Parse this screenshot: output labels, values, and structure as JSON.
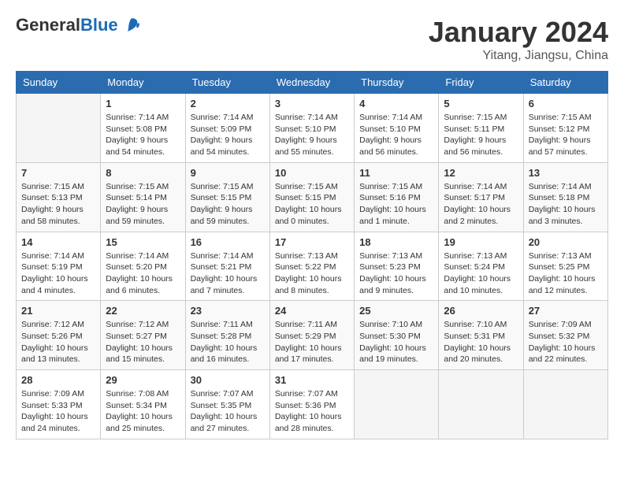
{
  "header": {
    "logo_general": "General",
    "logo_blue": "Blue",
    "month_title": "January 2024",
    "location": "Yitang, Jiangsu, China"
  },
  "weekdays": [
    "Sunday",
    "Monday",
    "Tuesday",
    "Wednesday",
    "Thursday",
    "Friday",
    "Saturday"
  ],
  "weeks": [
    [
      {
        "day": "",
        "info": ""
      },
      {
        "day": "1",
        "info": "Sunrise: 7:14 AM\nSunset: 5:08 PM\nDaylight: 9 hours\nand 54 minutes."
      },
      {
        "day": "2",
        "info": "Sunrise: 7:14 AM\nSunset: 5:09 PM\nDaylight: 9 hours\nand 54 minutes."
      },
      {
        "day": "3",
        "info": "Sunrise: 7:14 AM\nSunset: 5:10 PM\nDaylight: 9 hours\nand 55 minutes."
      },
      {
        "day": "4",
        "info": "Sunrise: 7:14 AM\nSunset: 5:10 PM\nDaylight: 9 hours\nand 56 minutes."
      },
      {
        "day": "5",
        "info": "Sunrise: 7:15 AM\nSunset: 5:11 PM\nDaylight: 9 hours\nand 56 minutes."
      },
      {
        "day": "6",
        "info": "Sunrise: 7:15 AM\nSunset: 5:12 PM\nDaylight: 9 hours\nand 57 minutes."
      }
    ],
    [
      {
        "day": "7",
        "info": "Sunrise: 7:15 AM\nSunset: 5:13 PM\nDaylight: 9 hours\nand 58 minutes."
      },
      {
        "day": "8",
        "info": "Sunrise: 7:15 AM\nSunset: 5:14 PM\nDaylight: 9 hours\nand 59 minutes."
      },
      {
        "day": "9",
        "info": "Sunrise: 7:15 AM\nSunset: 5:15 PM\nDaylight: 9 hours\nand 59 minutes."
      },
      {
        "day": "10",
        "info": "Sunrise: 7:15 AM\nSunset: 5:15 PM\nDaylight: 10 hours\nand 0 minutes."
      },
      {
        "day": "11",
        "info": "Sunrise: 7:15 AM\nSunset: 5:16 PM\nDaylight: 10 hours\nand 1 minute."
      },
      {
        "day": "12",
        "info": "Sunrise: 7:14 AM\nSunset: 5:17 PM\nDaylight: 10 hours\nand 2 minutes."
      },
      {
        "day": "13",
        "info": "Sunrise: 7:14 AM\nSunset: 5:18 PM\nDaylight: 10 hours\nand 3 minutes."
      }
    ],
    [
      {
        "day": "14",
        "info": "Sunrise: 7:14 AM\nSunset: 5:19 PM\nDaylight: 10 hours\nand 4 minutes."
      },
      {
        "day": "15",
        "info": "Sunrise: 7:14 AM\nSunset: 5:20 PM\nDaylight: 10 hours\nand 6 minutes."
      },
      {
        "day": "16",
        "info": "Sunrise: 7:14 AM\nSunset: 5:21 PM\nDaylight: 10 hours\nand 7 minutes."
      },
      {
        "day": "17",
        "info": "Sunrise: 7:13 AM\nSunset: 5:22 PM\nDaylight: 10 hours\nand 8 minutes."
      },
      {
        "day": "18",
        "info": "Sunrise: 7:13 AM\nSunset: 5:23 PM\nDaylight: 10 hours\nand 9 minutes."
      },
      {
        "day": "19",
        "info": "Sunrise: 7:13 AM\nSunset: 5:24 PM\nDaylight: 10 hours\nand 10 minutes."
      },
      {
        "day": "20",
        "info": "Sunrise: 7:13 AM\nSunset: 5:25 PM\nDaylight: 10 hours\nand 12 minutes."
      }
    ],
    [
      {
        "day": "21",
        "info": "Sunrise: 7:12 AM\nSunset: 5:26 PM\nDaylight: 10 hours\nand 13 minutes."
      },
      {
        "day": "22",
        "info": "Sunrise: 7:12 AM\nSunset: 5:27 PM\nDaylight: 10 hours\nand 15 minutes."
      },
      {
        "day": "23",
        "info": "Sunrise: 7:11 AM\nSunset: 5:28 PM\nDaylight: 10 hours\nand 16 minutes."
      },
      {
        "day": "24",
        "info": "Sunrise: 7:11 AM\nSunset: 5:29 PM\nDaylight: 10 hours\nand 17 minutes."
      },
      {
        "day": "25",
        "info": "Sunrise: 7:10 AM\nSunset: 5:30 PM\nDaylight: 10 hours\nand 19 minutes."
      },
      {
        "day": "26",
        "info": "Sunrise: 7:10 AM\nSunset: 5:31 PM\nDaylight: 10 hours\nand 20 minutes."
      },
      {
        "day": "27",
        "info": "Sunrise: 7:09 AM\nSunset: 5:32 PM\nDaylight: 10 hours\nand 22 minutes."
      }
    ],
    [
      {
        "day": "28",
        "info": "Sunrise: 7:09 AM\nSunset: 5:33 PM\nDaylight: 10 hours\nand 24 minutes."
      },
      {
        "day": "29",
        "info": "Sunrise: 7:08 AM\nSunset: 5:34 PM\nDaylight: 10 hours\nand 25 minutes."
      },
      {
        "day": "30",
        "info": "Sunrise: 7:07 AM\nSunset: 5:35 PM\nDaylight: 10 hours\nand 27 minutes."
      },
      {
        "day": "31",
        "info": "Sunrise: 7:07 AM\nSunset: 5:36 PM\nDaylight: 10 hours\nand 28 minutes."
      },
      {
        "day": "",
        "info": ""
      },
      {
        "day": "",
        "info": ""
      },
      {
        "day": "",
        "info": ""
      }
    ]
  ]
}
